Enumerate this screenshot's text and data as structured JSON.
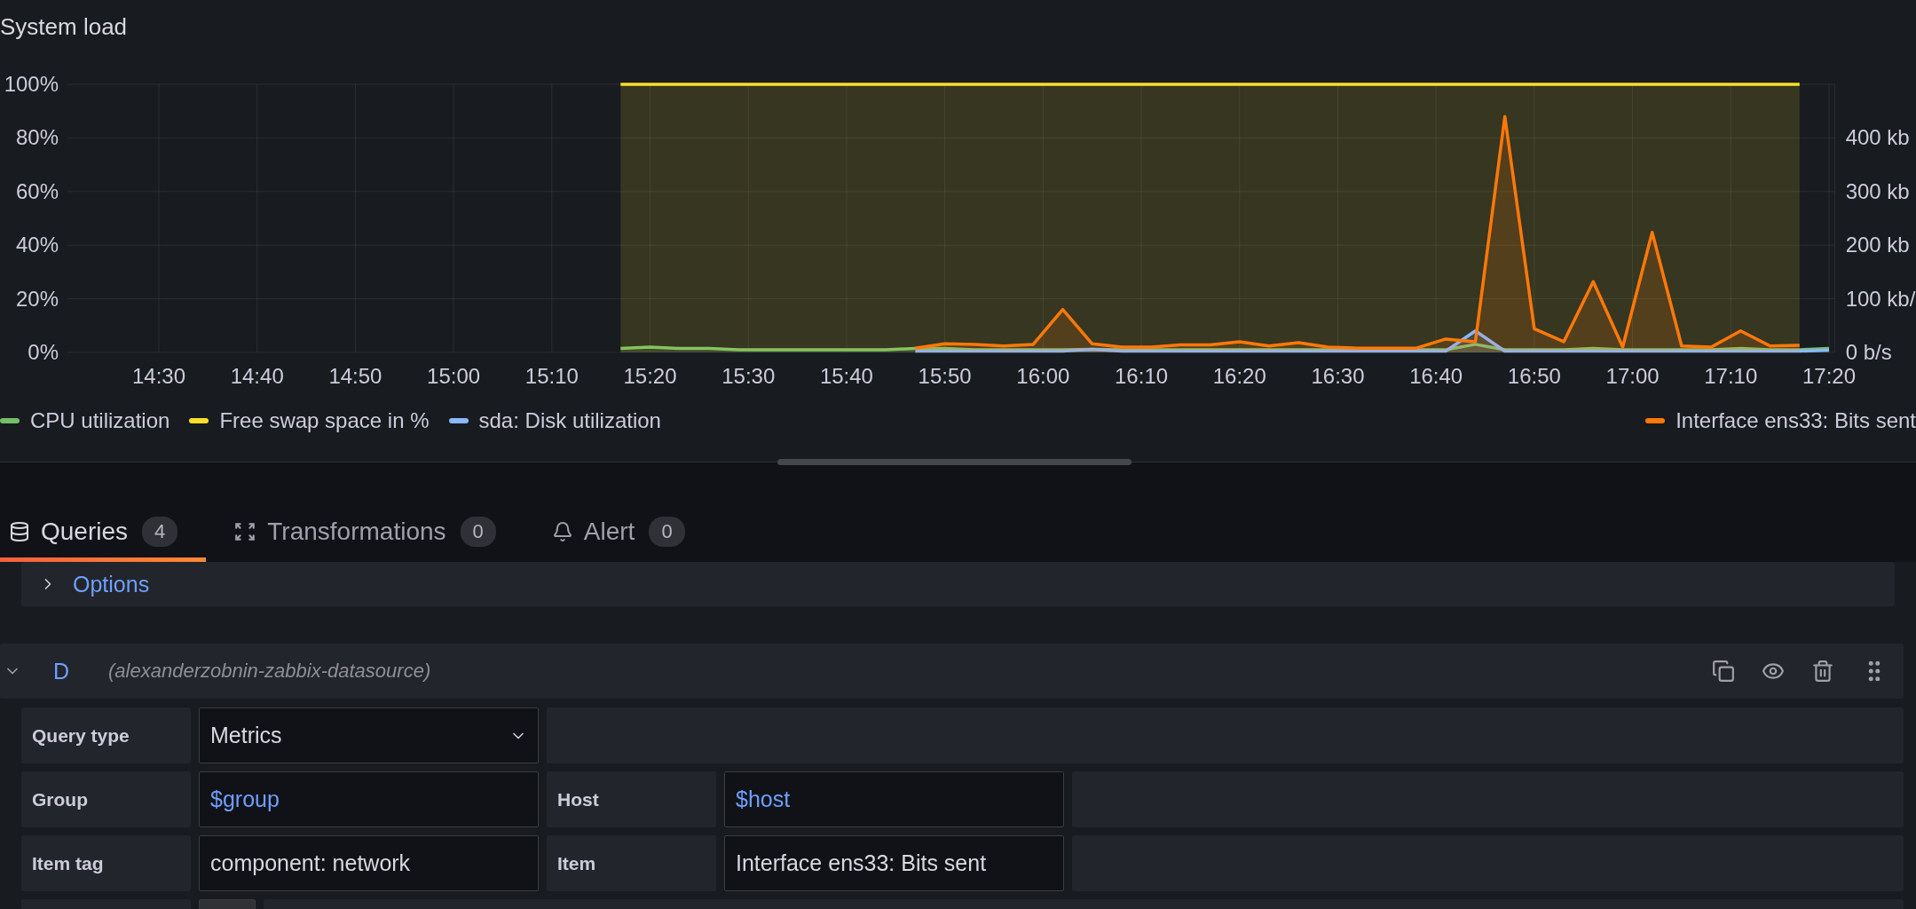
{
  "panel": {
    "chart_data": {
      "type": "area",
      "title": "System load",
      "x": [
        917,
        920,
        923,
        926,
        929,
        932,
        935,
        938,
        941,
        944,
        947,
        950,
        953,
        956,
        959,
        962,
        965,
        968,
        971,
        974,
        977,
        980,
        983,
        986,
        989,
        992,
        995,
        998,
        1001,
        1004,
        1007,
        1010,
        1013,
        1016,
        1019,
        1022,
        1025,
        1028,
        1031,
        1034,
        1037,
        1040
      ],
      "xlim": [
        860.7,
        1040.6
      ],
      "xticks": [
        {
          "value": 870,
          "label": "14:30"
        },
        {
          "value": 880,
          "label": "14:40"
        },
        {
          "value": 890,
          "label": "14:50"
        },
        {
          "value": 900,
          "label": "15:00"
        },
        {
          "value": 910,
          "label": "15:10"
        },
        {
          "value": 920,
          "label": "15:20"
        },
        {
          "value": 930,
          "label": "15:30"
        },
        {
          "value": 940,
          "label": "15:40"
        },
        {
          "value": 950,
          "label": "15:50"
        },
        {
          "value": 960,
          "label": "16:00"
        },
        {
          "value": 970,
          "label": "16:10"
        },
        {
          "value": 980,
          "label": "16:20"
        },
        {
          "value": 990,
          "label": "16:30"
        },
        {
          "value": 1000,
          "label": "16:40"
        },
        {
          "value": 1010,
          "label": "16:50"
        },
        {
          "value": 1020,
          "label": "17:00"
        },
        {
          "value": 1030,
          "label": "17:10"
        },
        {
          "value": 1040,
          "label": "17:20"
        }
      ],
      "ylim": [
        0,
        100
      ],
      "yticks": [
        {
          "value": 0,
          "label": "0%"
        },
        {
          "value": 20,
          "label": "20%"
        },
        {
          "value": 40,
          "label": "40%"
        },
        {
          "value": 60,
          "label": "60%"
        },
        {
          "value": 80,
          "label": "80%"
        },
        {
          "value": 100,
          "label": "100%"
        }
      ],
      "y2lim": [
        0,
        500
      ],
      "grid": true,
      "y2ticks": [
        {
          "value": 0,
          "label": "0 b/s"
        },
        {
          "value": 100,
          "label": "100 kb/"
        },
        {
          "value": 200,
          "label": "200 kb"
        },
        {
          "value": 300,
          "label": "300 kb"
        },
        {
          "value": 400,
          "label": "400 kb"
        }
      ],
      "series": [
        {
          "name": "CPU utilization",
          "color": "#73bf69",
          "values": [
            1.5,
            2,
            1.5,
            1.5,
            1,
            1,
            1,
            1,
            1,
            1,
            1.5,
            1.5,
            1,
            1,
            1,
            1,
            1.2,
            1,
            1,
            1,
            1,
            1,
            1,
            1,
            1,
            1,
            1,
            1,
            1,
            3,
            1,
            1,
            1,
            1.5,
            1,
            1,
            1,
            1,
            1.5,
            1,
            1,
            1.5
          ]
        },
        {
          "name": "Free swap space in %",
          "color": "#fade2a",
          "values": [
            100,
            100,
            100,
            100,
            100,
            100,
            100,
            100,
            100,
            100,
            100,
            100,
            100,
            100,
            100,
            100,
            100,
            100,
            100,
            100,
            100,
            100,
            100,
            100,
            100,
            100,
            100,
            100,
            100,
            100,
            100,
            100,
            100,
            100,
            100,
            100,
            100,
            100,
            100,
            100,
            100,
            null
          ]
        },
        {
          "name": "sda: Disk utilization",
          "color": "#8ab8ff",
          "values": [
            null,
            null,
            null,
            null,
            null,
            null,
            null,
            null,
            null,
            null,
            0.5,
            0.5,
            0.5,
            0.5,
            0.5,
            0.5,
            1.2,
            0.5,
            0.5,
            0.5,
            0.5,
            0.5,
            0.5,
            0.5,
            0.5,
            0.5,
            0.5,
            0.5,
            0.5,
            8,
            0.5,
            0.5,
            0.5,
            0.5,
            0.5,
            0.5,
            0.5,
            0.5,
            0.5,
            0.5,
            0.5,
            0.8
          ]
        },
        {
          "name": "Interface ens33: Bits sent",
          "color": "#ff780a",
          "axis": "y2",
          "values": [
            null,
            null,
            null,
            null,
            null,
            null,
            null,
            null,
            null,
            null,
            8,
            16,
            15,
            12,
            15,
            80,
            16,
            10,
            10,
            14,
            14,
            20,
            12,
            18,
            10,
            8,
            8,
            8,
            25,
            20,
            440,
            44,
            20,
            132,
            10,
            224,
            12,
            10,
            40,
            12,
            13,
            null
          ]
        }
      ]
    }
  },
  "tabs": [
    {
      "label": "Queries",
      "count": "4",
      "selected": true
    },
    {
      "label": "Transformations",
      "count": "0",
      "selected": false
    },
    {
      "label": "Alert",
      "count": "0",
      "selected": false
    }
  ],
  "options": {
    "label": "Options",
    "expanded": false
  },
  "query": {
    "ref": "D",
    "datasource": "(alexanderzobnin-zabbix-datasource)",
    "expanded": true,
    "rows": [
      [
        {
          "kind": "label",
          "text": "Query type"
        },
        {
          "kind": "select",
          "value": "Metrics"
        },
        {
          "kind": "filler"
        }
      ],
      [
        {
          "kind": "label",
          "text": "Group"
        },
        {
          "kind": "input",
          "value": "$group",
          "variable": true
        },
        {
          "kind": "label",
          "text": "Host"
        },
        {
          "kind": "input",
          "value": "$host",
          "variable": true
        },
        {
          "kind": "filler"
        }
      ],
      [
        {
          "kind": "label",
          "text": "Item tag"
        },
        {
          "kind": "input",
          "value": "component: network",
          "variable": false
        },
        {
          "kind": "label",
          "text": "Item"
        },
        {
          "kind": "input",
          "value": "Interface ens33: Bits sent",
          "variable": false
        },
        {
          "kind": "filler"
        }
      ],
      [
        {
          "kind": "label"
        },
        {
          "kind": "toggle"
        },
        {
          "kind": "filler"
        }
      ]
    ]
  }
}
